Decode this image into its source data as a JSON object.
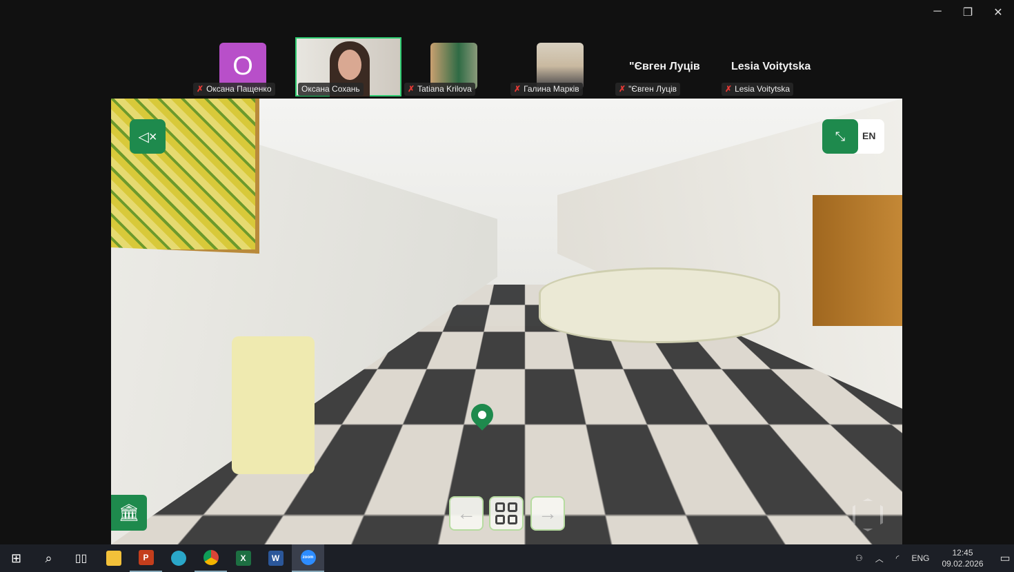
{
  "window_controls": {
    "minimize": "─",
    "restore": "❐",
    "close": "✕"
  },
  "participants": [
    {
      "name": "Оксана Пащенко",
      "initial": "O",
      "muted": true,
      "avatar_color": "#b84fc9"
    },
    {
      "name": "Оксана Сохань",
      "muted": false,
      "active_speaker": true
    },
    {
      "name": "Tatiana Krilova",
      "muted": true
    },
    {
      "name": "Галина Марків",
      "muted": true
    },
    {
      "name": "\"Євген Луців",
      "display_name": "\"Євген Луців",
      "muted": true
    },
    {
      "name": "Lesia Voitytska",
      "display_name": "Lesia Voitytska",
      "muted": true
    }
  ],
  "tour": {
    "language": "EN",
    "mute_icon": "🔇",
    "prev": "←",
    "next": "→",
    "accent": "#1e8a4d"
  },
  "taskbar": {
    "apps": [
      "start",
      "search",
      "task-view",
      "file-explorer",
      "powerpoint",
      "edge",
      "chrome",
      "excel",
      "word",
      "zoom"
    ],
    "lang": "ENG",
    "time": "12:45",
    "date": "09.02.2026",
    "app_labels": {
      "ppt": "P",
      "xls": "X",
      "doc": "W",
      "zoom": "zoom"
    }
  }
}
